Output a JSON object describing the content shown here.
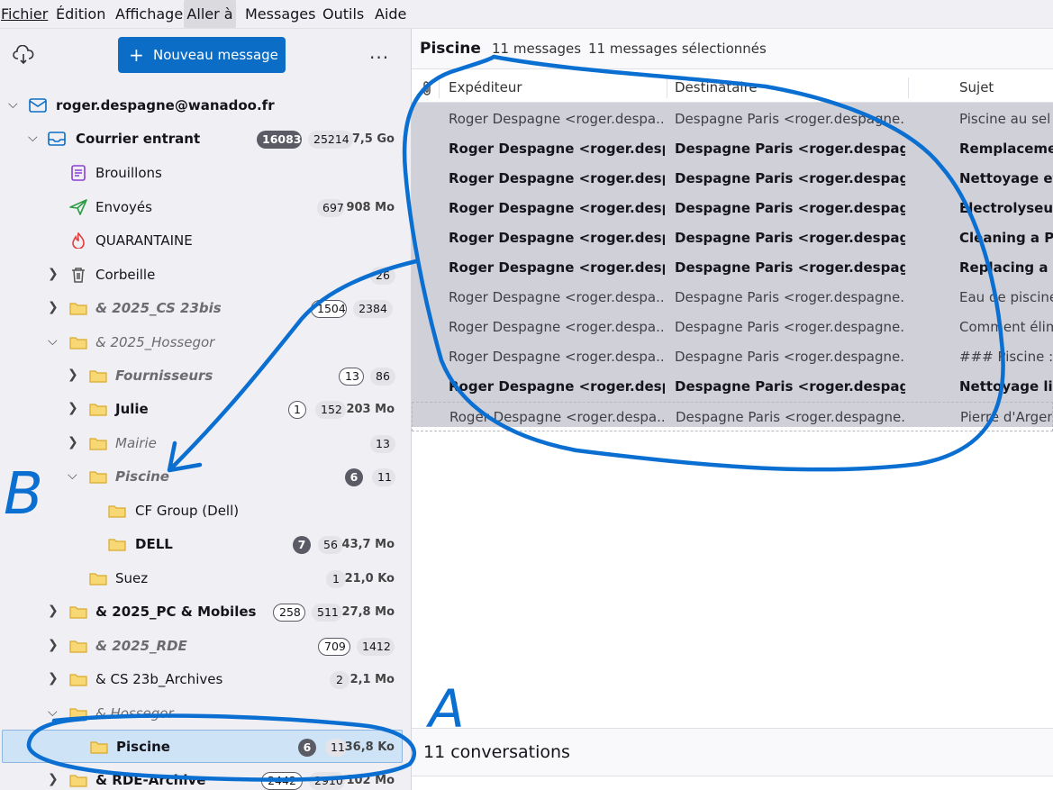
{
  "menu": [
    "Fichier",
    "Édition",
    "Affichage",
    "Aller à",
    "Messages",
    "Outils",
    "Aide"
  ],
  "menu_underline": [
    "F",
    "É",
    "A",
    "A",
    "M",
    "O",
    "A"
  ],
  "toolbar": {
    "new_message": "Nouveau message",
    "more": "..."
  },
  "account": {
    "name": "roger.despagne@wanadoo.fr"
  },
  "folders": [
    {
      "label": "Courrier entrant",
      "b1": "16083",
      "b2": "25214",
      "size": "7,5 Go"
    },
    {
      "label": "Brouillons"
    },
    {
      "label": "Envoyés",
      "b2": "697",
      "size": "908 Mo"
    },
    {
      "label": "QUARANTAINE"
    },
    {
      "label": "Corbeille",
      "b2": "26"
    },
    {
      "label": "& 2025_CS 23bis",
      "b1": "1504",
      "b2": "2384"
    },
    {
      "label": "& 2025_Hossegor"
    },
    {
      "label": "Fournisseurs",
      "b1": "13",
      "b2": "86"
    },
    {
      "label": "Julie",
      "b1": "1",
      "b2": "152",
      "size": "203 Mo"
    },
    {
      "label": "Mairie",
      "b2": "13"
    },
    {
      "label": "Piscine",
      "b1": "6",
      "b2": "11"
    },
    {
      "label": "CF Group (Dell)"
    },
    {
      "label": "DELL",
      "b1": "7",
      "b2": "56",
      "size": "43,7 Mo"
    },
    {
      "label": "Suez",
      "b2": "1",
      "size": "21,0 Ko"
    },
    {
      "label": "& 2025_PC & Mobiles",
      "b1": "258",
      "b2": "511",
      "size": "27,8 Mo"
    },
    {
      "label": "& 2025_RDE",
      "b1": "709",
      "b2": "1412"
    },
    {
      "label": "& CS 23b_Archives",
      "b2": "2",
      "size": "2,1 Mo"
    },
    {
      "label": "& Hossegor"
    },
    {
      "label": "Piscine",
      "b1": "6",
      "b2": "11",
      "size": "36,8 Ko"
    },
    {
      "label": "& RDE-Archive",
      "b1": "2442",
      "b2": "2910",
      "size": "102 Mo"
    }
  ],
  "header": {
    "title": "Piscine",
    "count": "11 messages",
    "selected": "11 messages sélectionnés"
  },
  "columns": {
    "from": "Expéditeur",
    "to": "Destinataire",
    "subject": "Sujet"
  },
  "messages": [
    {
      "from": "Roger Despagne <roger.despa...",
      "to": "Despagne Paris <roger.despagne...",
      "subject": "Piscine au sel : ...",
      "unread": false
    },
    {
      "from": "Roger Despagne <roger.desp...",
      "to": "Despagne Paris <roger.despag...",
      "subject": "Remplacement",
      "unread": true
    },
    {
      "from": "Roger Despagne <roger.desp...",
      "to": "Despagne Paris <roger.despag...",
      "subject": "Nettoyage et",
      "unread": true
    },
    {
      "from": "Roger Despagne <roger.desp...",
      "to": "Despagne Paris <roger.despag...",
      "subject": "Electrolyseur a",
      "unread": true
    },
    {
      "from": "Roger Despagne <roger.desp...",
      "to": "Despagne Paris <roger.despag...",
      "subject": "Cleaning a Pen",
      "unread": true
    },
    {
      "from": "Roger Despagne <roger.desp...",
      "to": "Despagne Paris <roger.despag...",
      "subject": "Replacing a Po",
      "unread": true
    },
    {
      "from": "Roger Despagne <roger.despa...",
      "to": "Despagne Paris <roger.despagne...",
      "subject": "Eau de piscine",
      "unread": false
    },
    {
      "from": "Roger Despagne <roger.despa...",
      "to": "Despagne Paris <roger.despagne...",
      "subject": "Comment élim",
      "unread": false
    },
    {
      "from": "Roger Despagne <roger.despa...",
      "to": "Despagne Paris <roger.despagne...",
      "subject": "### Piscine : La",
      "unread": false
    },
    {
      "from": "Roger Despagne <roger.despa...",
      "to": "Despagne Paris <roger.despag...",
      "subject": "Nettoyage lig",
      "unread": true
    },
    {
      "from": "Roger Despagne <roger.despa...",
      "to": "Despagne Paris <roger.despagne...",
      "subject": "Pierre d'Argent",
      "unread": false
    }
  ],
  "status": {
    "text": "11 conversations"
  },
  "annotations": {
    "a": "A",
    "b": "B"
  },
  "colors": {
    "accent": "#0b6dc6",
    "annotation": "#0a6fd1",
    "selection": "#d0d0d8"
  }
}
